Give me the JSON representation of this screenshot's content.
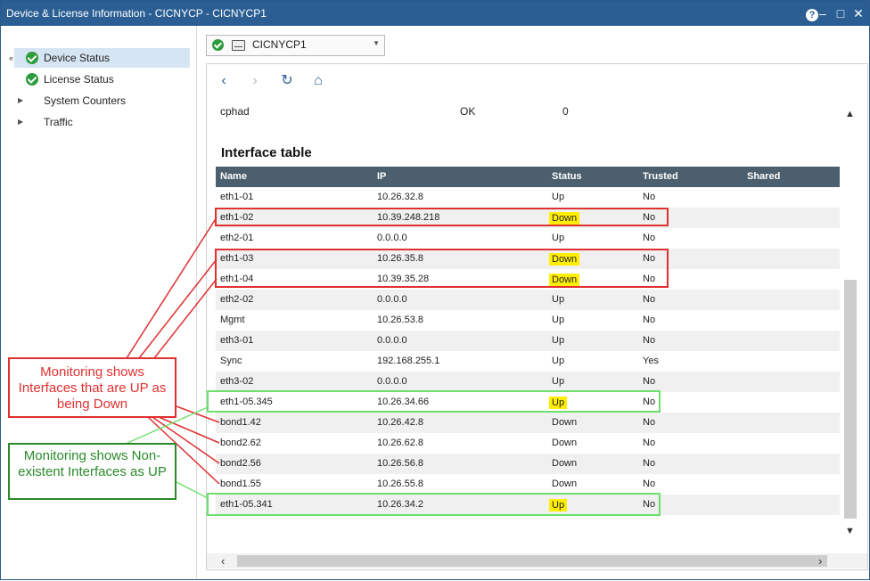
{
  "window": {
    "title": "Device & License Information - CICNYCP - CICNYCP1",
    "help_label": "?",
    "minimize_label": "–",
    "maximize_label": "□",
    "close_label": "✕"
  },
  "sidebar": {
    "collapse_label": "«",
    "items": [
      {
        "label": "Device Status",
        "icon": "check-circle-icon",
        "active": true
      },
      {
        "label": "License Status",
        "icon": "check-circle-icon",
        "active": false
      },
      {
        "label": "System Counters",
        "icon": "expand-arrow-icon",
        "active": false
      },
      {
        "label": "Traffic",
        "icon": "expand-arrow-icon",
        "active": false
      }
    ]
  },
  "device_selector": {
    "value": "CICNYCP1",
    "status_color": "#2e9b3d"
  },
  "toolbar": {
    "back_icon": "‹",
    "forward_icon": "›",
    "refresh_icon": "↻",
    "home_icon": "⌂"
  },
  "partial_row": {
    "name": "cphad",
    "status": "OK",
    "value": "0"
  },
  "interface_table": {
    "title": "Interface table",
    "columns": [
      "Name",
      "IP",
      "Status",
      "Trusted",
      "Shared"
    ],
    "rows": [
      {
        "name": "eth1-01",
        "ip": "10.26.32.8",
        "status": "Up",
        "trusted": "No",
        "shared": ""
      },
      {
        "name": "eth1-02",
        "ip": "10.39.248.218",
        "status": "Down",
        "trusted": "No",
        "shared": ""
      },
      {
        "name": "eth2-01",
        "ip": "0.0.0.0",
        "status": "Up",
        "trusted": "No",
        "shared": ""
      },
      {
        "name": "eth1-03",
        "ip": "10.26.35.8",
        "status": "Down",
        "trusted": "No",
        "shared": ""
      },
      {
        "name": "eth1-04",
        "ip": "10.39.35.28",
        "status": "Down",
        "trusted": "No",
        "shared": ""
      },
      {
        "name": "eth2-02",
        "ip": "0.0.0.0",
        "status": "Up",
        "trusted": "No",
        "shared": ""
      },
      {
        "name": "Mgmt",
        "ip": "10.26.53.8",
        "status": "Up",
        "trusted": "No",
        "shared": ""
      },
      {
        "name": "eth3-01",
        "ip": "0.0.0.0",
        "status": "Up",
        "trusted": "No",
        "shared": ""
      },
      {
        "name": "Sync",
        "ip": "192.168.255.1",
        "status": "Up",
        "trusted": "Yes",
        "shared": ""
      },
      {
        "name": "eth3-02",
        "ip": "0.0.0.0",
        "status": "Up",
        "trusted": "No",
        "shared": ""
      },
      {
        "name": "eth1-05.345",
        "ip": "10.26.34.66",
        "status": "Up",
        "trusted": "No",
        "shared": ""
      },
      {
        "name": "bond1.42",
        "ip": "10.26.42.8",
        "status": "Down",
        "trusted": "No",
        "shared": ""
      },
      {
        "name": "bond2.62",
        "ip": "10.26.62.8",
        "status": "Down",
        "trusted": "No",
        "shared": ""
      },
      {
        "name": "bond2.56",
        "ip": "10.26.56.8",
        "status": "Down",
        "trusted": "No",
        "shared": ""
      },
      {
        "name": "bond1.55",
        "ip": "10.26.55.8",
        "status": "Down",
        "trusted": "No",
        "shared": ""
      },
      {
        "name": "eth1-05.341",
        "ip": "10.26.34.2",
        "status": "Up",
        "trusted": "No",
        "shared": ""
      }
    ]
  },
  "annotations": {
    "red_note": "Monitoring shows Interfaces that are UP as being Down",
    "green_note": "Monitoring shows Non-existent Interfaces as UP",
    "red_color": "#e03030",
    "green_color": "#2a8a2a",
    "highlight_color": "#ffee00"
  }
}
